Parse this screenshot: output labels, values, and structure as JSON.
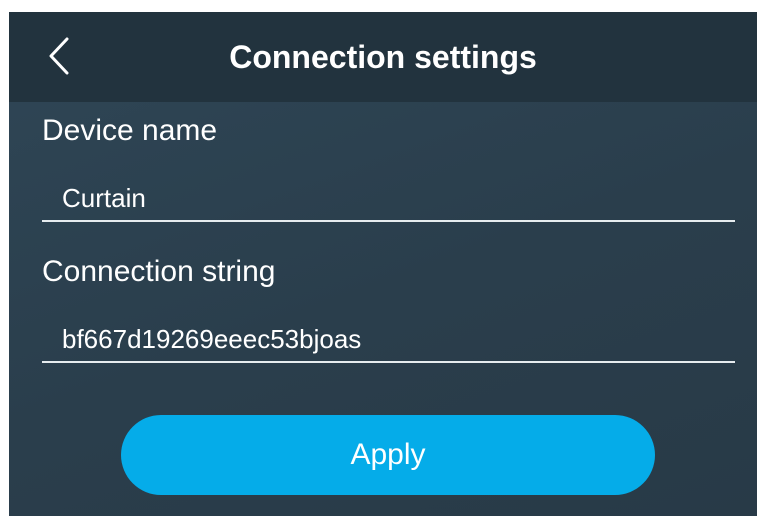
{
  "header": {
    "title": "Connection settings",
    "back_icon": "chevron-left-icon"
  },
  "fields": {
    "device_name": {
      "label": "Device name",
      "value": "Curtain"
    },
    "connection_string": {
      "label": "Connection string",
      "value": "bf667d19269eeec53bjoas"
    }
  },
  "actions": {
    "apply_label": "Apply"
  },
  "colors": {
    "header_bg": "#22333e",
    "screen_bg": "#2c4150",
    "accent": "#05ace9",
    "text": "#ffffff"
  }
}
